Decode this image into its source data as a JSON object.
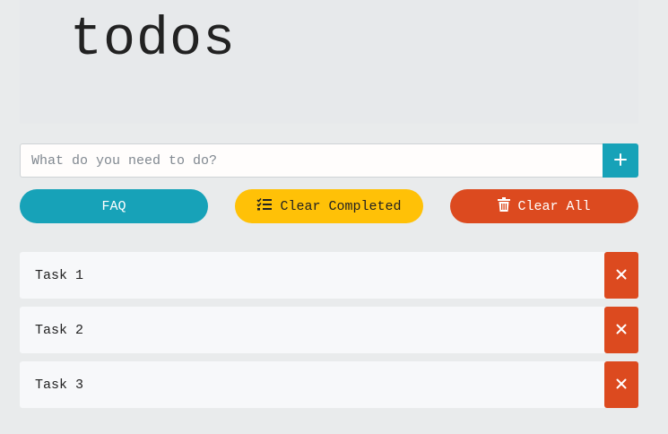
{
  "header": {
    "title": "todos"
  },
  "input": {
    "placeholder": "What do you need to do?",
    "value": ""
  },
  "buttons": {
    "add_icon": "plus-icon",
    "faq": "FAQ",
    "clear_completed": "Clear Completed",
    "clear_completed_icon": "tasks-list-icon",
    "clear_all": "Clear All",
    "clear_all_icon": "trash-icon"
  },
  "tasks": [
    {
      "label": "Task 1"
    },
    {
      "label": "Task 2"
    },
    {
      "label": "Task 3"
    }
  ],
  "colors": {
    "teal": "#17a2b8",
    "yellow": "#ffc107",
    "red": "#dc4a1f",
    "background": "#e9ebec"
  }
}
